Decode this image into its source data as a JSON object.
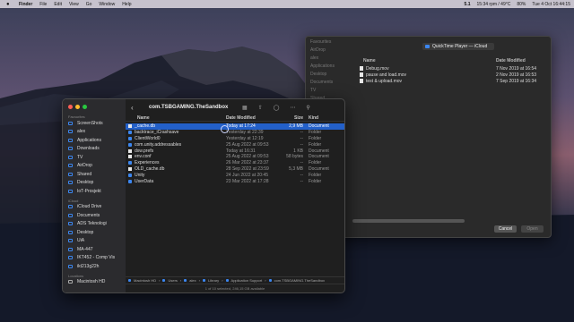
{
  "menubar": {
    "app": "Finder",
    "items": [
      "File",
      "Edit",
      "View",
      "Go",
      "Window",
      "Help"
    ],
    "status": [
      "5.1",
      "15:34 rpm / 49°C",
      "80%",
      "Tue 4 Oct  16:44:15"
    ]
  },
  "back_window": {
    "path": "QuickTime Player — iCloud",
    "sidebar": [
      "Favourites",
      "AirDrop",
      "alex",
      "Applications",
      "Desktop",
      "Documents",
      "TV",
      "Shared"
    ],
    "columns": {
      "name": "Name",
      "date": "Date Modified"
    },
    "files": [
      {
        "name": "Debug.mov",
        "date": "7 Nov 2019 at 16:54"
      },
      {
        "name": "pause and load.mov",
        "date": "2 Nov 2019 at 16:53"
      },
      {
        "name": "test & upload.mov",
        "date": "7 Sep 2019 at 16:34"
      }
    ],
    "cancel": "Cancel",
    "open": "Open"
  },
  "finder": {
    "title": "com.TSBGAMING.TheSandbox",
    "sidebar": {
      "favourites_label": "Favourites",
      "favourites": [
        "ScreenShots",
        "alex",
        "Applications",
        "Downloads",
        "TV",
        "AirDrop",
        "Shared",
        "Desktop",
        "IoT-Prosjekt"
      ],
      "icloud_label": "iCloud",
      "icloud": [
        "iCloud Drive",
        "Documents",
        "ADS Teknologi",
        "Desktop",
        "UiA",
        "MA-447",
        "IKT452 - Comp Vis",
        "ikt213g22h"
      ],
      "locations_label": "Locations",
      "locations": [
        "Macintosh HD"
      ]
    },
    "columns": {
      "name": "Name",
      "date": "Date Modified",
      "size": "Size",
      "kind": "Kind"
    },
    "files": [
      {
        "name": "_cache.db",
        "date": "Today at 17:24",
        "size": "2,9 MB",
        "kind": "Document",
        "type": "file",
        "selected": true
      },
      {
        "name": "backtrace_iCrashsave",
        "date": "Yesterday at 22:39",
        "size": "--",
        "kind": "Folder",
        "type": "folder"
      },
      {
        "name": "ClientWorld0",
        "date": "Yesterday at 12:19",
        "size": "--",
        "kind": "Folder",
        "type": "folder"
      },
      {
        "name": "com.unity.addressables",
        "date": "25 Aug 2022 at 09:53",
        "size": "--",
        "kind": "Folder",
        "type": "folder"
      },
      {
        "name": "dxw.prefs",
        "date": "Today at 16:31",
        "size": "1 KB",
        "kind": "Document",
        "type": "file"
      },
      {
        "name": "env.conf",
        "date": "25 Aug 2022 at 09:53",
        "size": "58 bytes",
        "kind": "Document",
        "type": "file"
      },
      {
        "name": "Experiences",
        "date": "26 Mar 2022 at 23:37",
        "size": "--",
        "kind": "Folder",
        "type": "folder"
      },
      {
        "name": "OLD_cache.db",
        "date": "28 Sep 2022 at 23:59",
        "size": "5,3 MB",
        "kind": "Document",
        "type": "file"
      },
      {
        "name": "Unity",
        "date": "24 Jun 2022 at 20:45",
        "size": "--",
        "kind": "Folder",
        "type": "folder"
      },
      {
        "name": "UserData",
        "date": "23 Mar 2022 at 17:28",
        "size": "--",
        "kind": "Folder",
        "type": "folder"
      }
    ],
    "path": [
      "Macintosh HD",
      "Users",
      "alex",
      "Library",
      "Application Support",
      "com.TSBGAMING.TheSandbox"
    ],
    "status": "1 of 10 selected, 246,15 GB available"
  }
}
